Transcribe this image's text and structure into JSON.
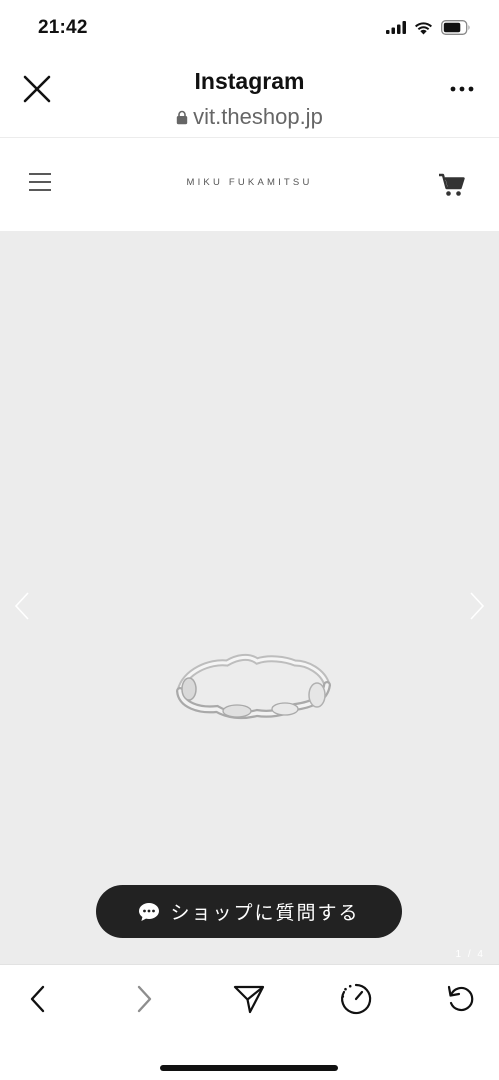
{
  "status_bar": {
    "time": "21:42",
    "icons": [
      "signal-icon",
      "wifi-icon",
      "battery-icon"
    ]
  },
  "browser_header": {
    "title": "Instagram",
    "url": "vit.theshop.jp",
    "close_icon": "close-icon",
    "more_icon": "more-icon",
    "lock_icon": "lock-icon"
  },
  "shop_header": {
    "brand": "MIKU FUKAMITSU",
    "menu_icon": "hamburger-menu-icon",
    "cart_icon": "cart-icon"
  },
  "product": {
    "image_description_icon": "ring-image",
    "pager": "1 / 4",
    "ask_button_label": "ショップに質問する",
    "chat_icon": "chat-bubble-icon"
  },
  "toolbar": {
    "buttons": [
      "back-icon",
      "forward-icon",
      "share-icon",
      "speed-icon",
      "reload-icon"
    ]
  },
  "colors": {
    "image_background": "#ececec",
    "ask_button": "#222222",
    "url_text": "#666666"
  }
}
